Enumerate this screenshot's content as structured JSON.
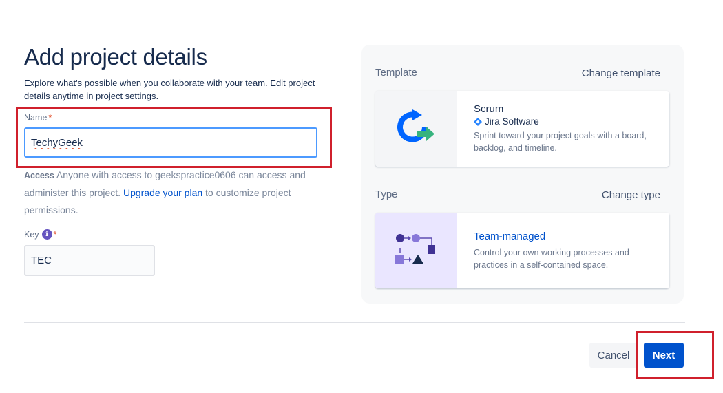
{
  "page": {
    "title": "Add project details",
    "intro": "Explore what's possible when you collaborate with your team. Edit project details anytime in project settings."
  },
  "form": {
    "name_label": "Name",
    "required_mark": "*",
    "name_value": "TechyGeek",
    "access_label": "Access",
    "access_text": "Anyone with access to geekspractice0606 can access and administer this project.",
    "upgrade_link": "Upgrade your plan",
    "access_suffix": "to customize project permissions.",
    "key_label": "Key",
    "info_glyph": "i",
    "key_value": "TEC"
  },
  "template": {
    "section_label": "Template",
    "change_label": "Change template",
    "card": {
      "title": "Scrum",
      "product": "Jira Software",
      "description": "Sprint toward your project goals with a board, backlog, and timeline."
    }
  },
  "type": {
    "section_label": "Type",
    "change_label": "Change type",
    "card": {
      "title": "Team-managed",
      "description": "Control your own working processes and practices in a self-contained space."
    }
  },
  "footer": {
    "cancel_label": "Cancel",
    "next_label": "Next"
  },
  "colors": {
    "primary": "#0052cc",
    "highlight": "#d0202c",
    "focus": "#4c9aff",
    "purple": "#6554c0"
  }
}
